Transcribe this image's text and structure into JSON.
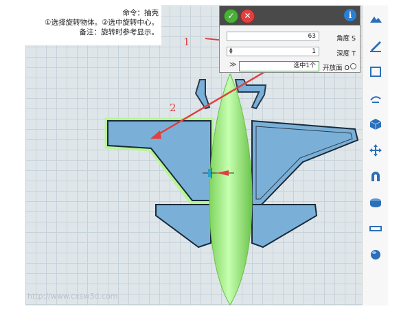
{
  "info": {
    "line1": "命令：抽壳",
    "line2": "①选择旋转物体。②选中旋转中心。",
    "line3": "备注：旋转时参考显示。"
  },
  "panel": {
    "angle_label": "角度 S",
    "angle_value": "63",
    "depth_label": "深度 T",
    "depth_value": "1",
    "face_label": "开放面 O",
    "face_value": "选中1个"
  },
  "annotations": {
    "label_1": "1",
    "label_2": "2"
  },
  "watermark": "http://www.cxsw3d.com",
  "colors": {
    "wing_fill": "#7ab0d8",
    "fuselage": "#9ef27a",
    "highlight": "#b8f596",
    "arrow": "#e04040",
    "header": "#4a4a4a"
  },
  "toolbar": {
    "icons": [
      "primitive-tool-icon",
      "sketch-tool-icon",
      "sketch-edit-icon",
      "3d-sketch-icon",
      "solid-icon",
      "transform-icon",
      "magnet-icon",
      "combine-icon",
      "measure-icon",
      "material-icon"
    ]
  }
}
